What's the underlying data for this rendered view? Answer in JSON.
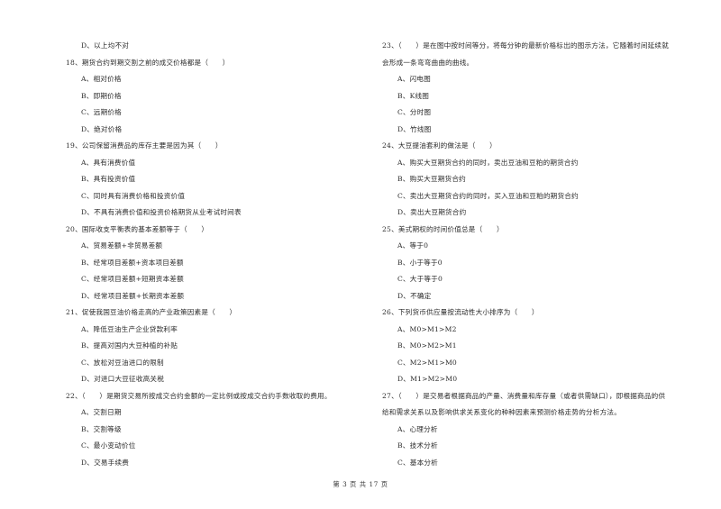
{
  "left_column": {
    "lead_option": "D、以上均不对",
    "questions": [
      {
        "number": "18",
        "stem": "18、期货合约到期交割之前的成交价格都是（　　）",
        "options": [
          "A、相对价格",
          "B、即期价格",
          "C、远期价格",
          "D、绝对价格"
        ]
      },
      {
        "number": "19",
        "stem": "19、公司保留消费品的库存主要是因为其（　　）",
        "options": [
          "A、具有消费价值",
          "B、具有投资价值",
          "C、同时具有消费价格和投资价值",
          "D、不具有消费价值和投资价格期货从业考试时间表"
        ]
      },
      {
        "number": "20",
        "stem": "20、国际收支平衡表的基本差额等于（　　）",
        "options": [
          "A、贸易差额+非贸易差额",
          "B、经常项目差额+资本项目差额",
          "C、经常项目差额+短期资本差额",
          "D、经常项目差额+长期资本差额"
        ]
      },
      {
        "number": "21",
        "stem": "21、促使我国豆油价格走高的产业政策因素是（　　）",
        "options": [
          "A、降低豆油生产企业贷款利率",
          "B、提高对国内大豆种植的补贴",
          "C、放松对豆油进口的限制",
          "D、对进口大豆征收高关税"
        ]
      },
      {
        "number": "22",
        "stem": "22、（　　）是期货交易所按成交合约金额的一定比例或按成交合约手数收取的费用。",
        "options": [
          "A、交割日期",
          "B、交割等级",
          "C、最小变动价位",
          "D、交易手续费"
        ]
      }
    ]
  },
  "right_column": {
    "questions": [
      {
        "number": "23",
        "stem_line1": "23、（　　）是在图中按时间等分，将每分钟的最新价格标出的图示方法，它随着时间延续就",
        "stem_line2": "会形成一条弯弯曲曲的曲线。",
        "options": [
          "A、闪电图",
          "B、K线图",
          "C、分时图",
          "D、竹线图"
        ]
      },
      {
        "number": "24",
        "stem_line1": "24、大豆提油套利的做法是（　　）",
        "options": [
          "A、购买大豆期货合约的同时，卖出豆油和豆粕的期货合约",
          "B、购买大豆期货合约",
          "C、卖出大豆期货合约的同时，买入豆油和豆粕的期货合约",
          "D、卖出大豆期货合约"
        ]
      },
      {
        "number": "25",
        "stem_line1": "25、美式期权的时间价值总是（　　）",
        "options": [
          "A、等于0",
          "B、小于等于0",
          "C、大于等于0",
          "D、不确定"
        ]
      },
      {
        "number": "26",
        "stem_line1": "26、下列货币供应量按流动性大小排序为（　　）",
        "options": [
          "A、M0>M1>M2",
          "B、M0>M2>M1",
          "C、M2>M1>M0",
          "D、M1>M2>M0"
        ]
      },
      {
        "number": "27",
        "stem_line1": "27、（　　）是交易者根据商品的产量、消费量和库存量（或者供需缺口），即根据商品的供",
        "stem_line2": "给和需求关系以及影响供求关系变化的种种因素来预测价格走势的分析方法。",
        "options": [
          "A、心理分析",
          "B、技术分析",
          "C、基本分析"
        ]
      }
    ]
  },
  "footer": {
    "page_label": "第 3 页 共 17 页"
  }
}
